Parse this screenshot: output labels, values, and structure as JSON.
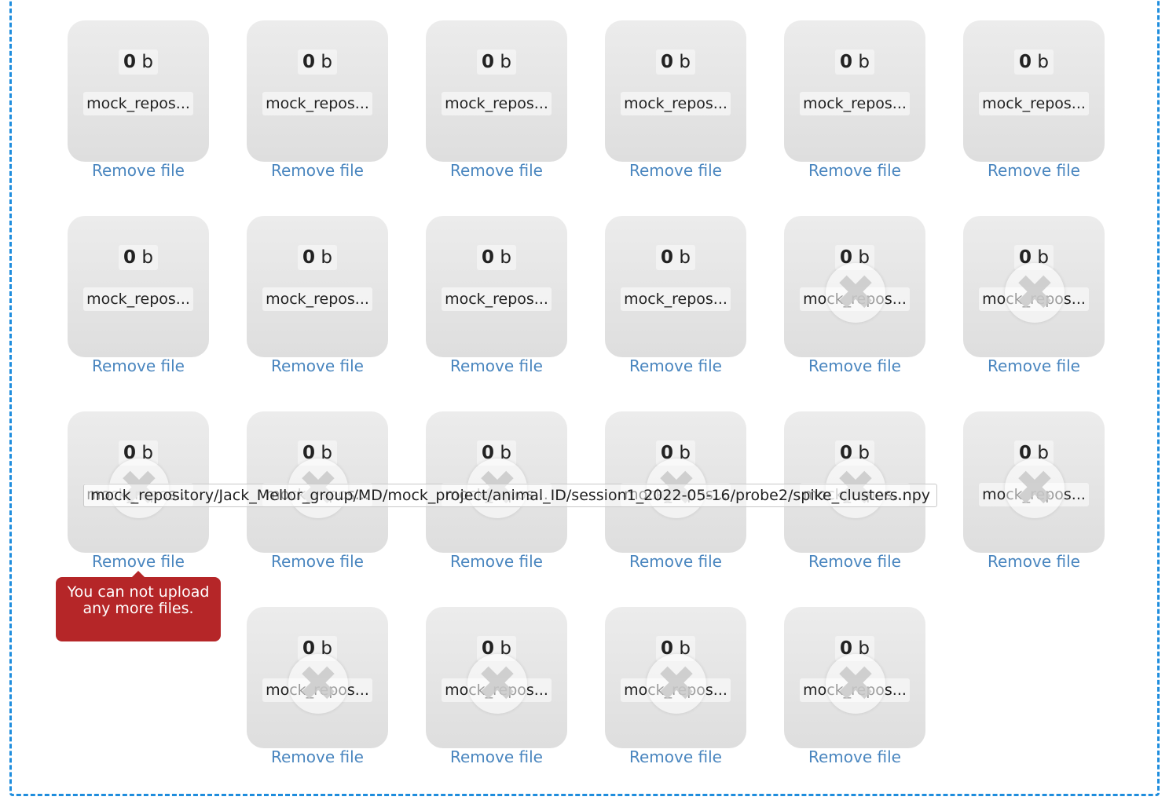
{
  "dropzone": {
    "max_files_error": "You can not upload any more files.",
    "hover_filename": "mock_repository/Jack_Mellor_group/MD/mock_project/animal_ID/session1_2022-05-16/probe2/spike_clusters.npy",
    "remove_label": "Remove file",
    "size_value": "0",
    "size_unit": "b",
    "file_label": "mock_repos...",
    "error_icon": "x-icon",
    "files": [
      {
        "row": 1,
        "col": 1,
        "error": false
      },
      {
        "row": 1,
        "col": 2,
        "error": false
      },
      {
        "row": 1,
        "col": 3,
        "error": false
      },
      {
        "row": 1,
        "col": 4,
        "error": false
      },
      {
        "row": 1,
        "col": 5,
        "error": false
      },
      {
        "row": 1,
        "col": 6,
        "error": false
      },
      {
        "row": 2,
        "col": 1,
        "error": false
      },
      {
        "row": 2,
        "col": 2,
        "error": false
      },
      {
        "row": 2,
        "col": 3,
        "error": false
      },
      {
        "row": 2,
        "col": 4,
        "error": false
      },
      {
        "row": 2,
        "col": 5,
        "error": true
      },
      {
        "row": 2,
        "col": 6,
        "error": true
      },
      {
        "row": 3,
        "col": 1,
        "error": true
      },
      {
        "row": 3,
        "col": 2,
        "error": true
      },
      {
        "row": 3,
        "col": 3,
        "error": true
      },
      {
        "row": 3,
        "col": 4,
        "error": true
      },
      {
        "row": 3,
        "col": 5,
        "error": true
      },
      {
        "row": 3,
        "col": 6,
        "error": true
      },
      {
        "row": 4,
        "col": 2,
        "error": true
      },
      {
        "row": 4,
        "col": 3,
        "error": true
      },
      {
        "row": 4,
        "col": 4,
        "error": true
      },
      {
        "row": 4,
        "col": 5,
        "error": true
      }
    ]
  }
}
